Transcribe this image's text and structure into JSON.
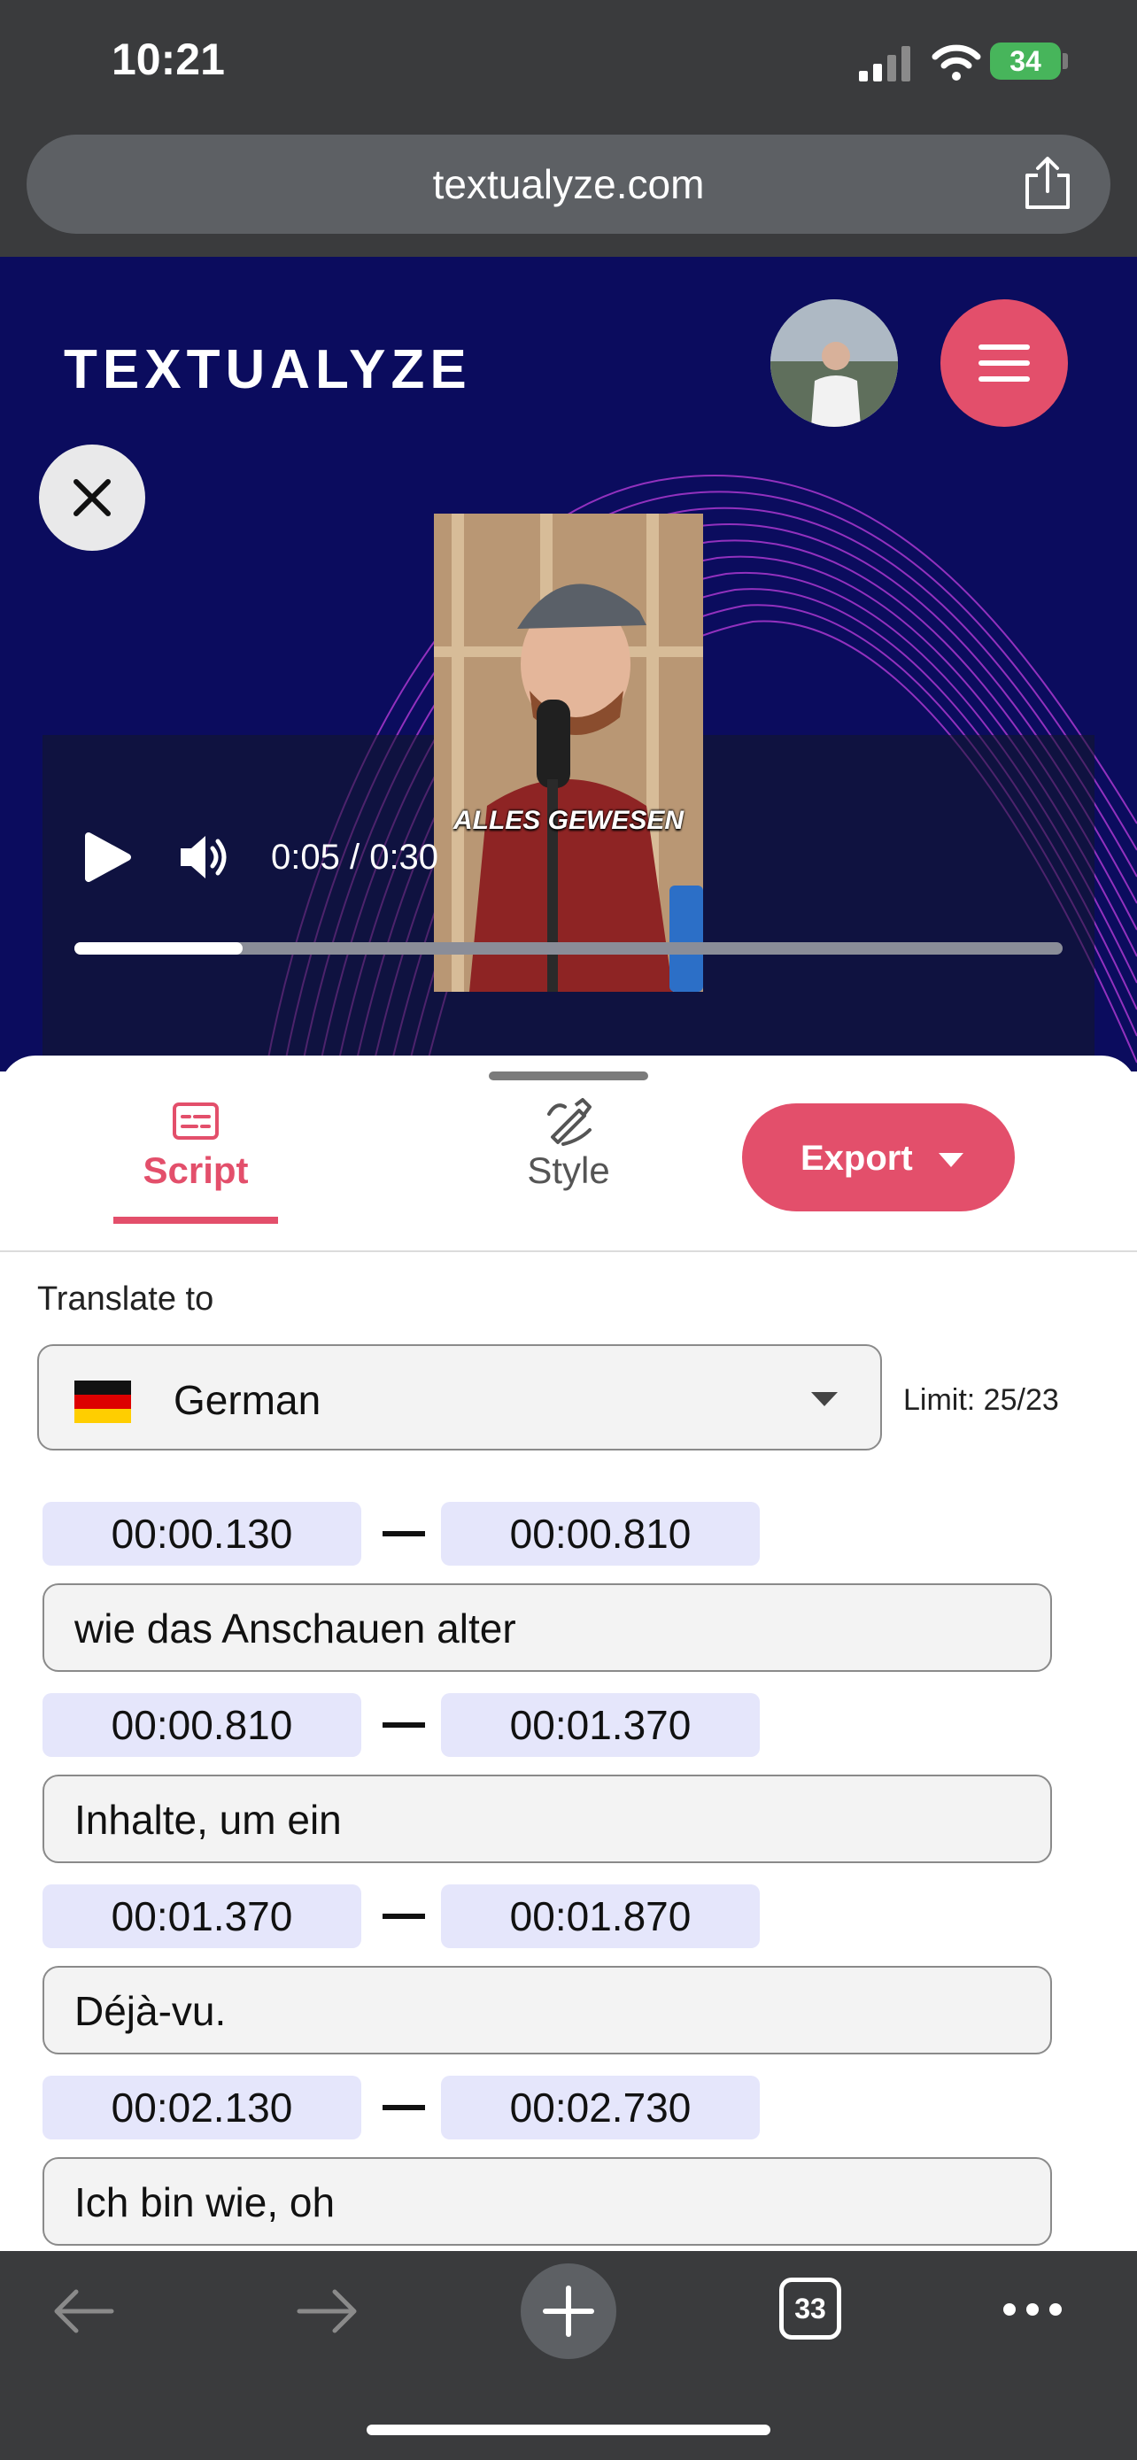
{
  "status_bar": {
    "time": "10:21",
    "battery": "34"
  },
  "browser": {
    "url": "textualyze.com",
    "tab_count": "33"
  },
  "header": {
    "brand": "TEXTUALYZE"
  },
  "player": {
    "time_display": "0:05 / 0:30",
    "caption": "ALLES GEWESEN",
    "progress": 0.17
  },
  "tabs": {
    "script_label": "Script",
    "style_label": "Style",
    "export_label": "Export"
  },
  "translate": {
    "label": "Translate to",
    "language": "German",
    "limit": "Limit: 25/23"
  },
  "segments": [
    {
      "start": "00:00.130",
      "end": "00:00.810",
      "text": "wie das Anschauen alter"
    },
    {
      "start": "00:00.810",
      "end": "00:01.370",
      "text": "Inhalte, um ein"
    },
    {
      "start": "00:01.370",
      "end": "00:01.870",
      "text": "Déjà-vu."
    },
    {
      "start": "00:02.130",
      "end": "00:02.730",
      "text": "Ich bin wie, oh"
    }
  ],
  "colors": {
    "accent": "#e34f6b",
    "hero_bg": "#0b0c5e",
    "timecode_bg": "#e5e6fb"
  }
}
